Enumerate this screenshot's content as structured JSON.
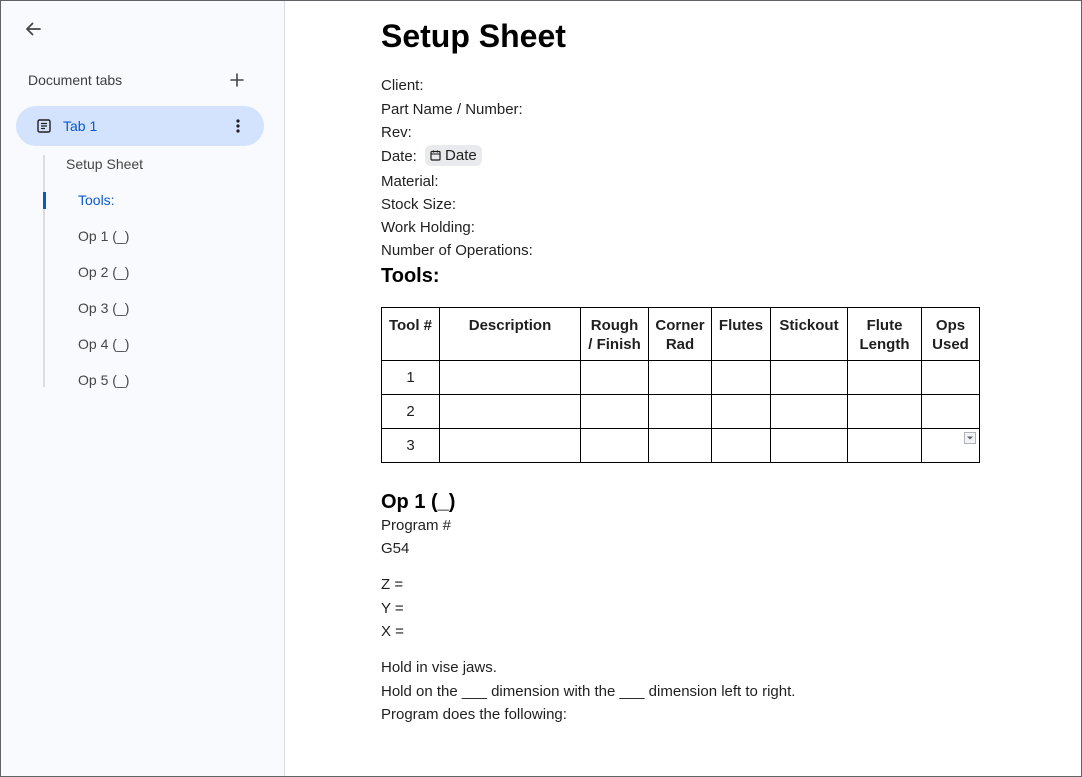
{
  "sidebar": {
    "tabs_header": "Document tabs",
    "active_tab": {
      "label": "Tab 1"
    },
    "outline": [
      {
        "label": "Setup Sheet",
        "active": false
      },
      {
        "label": "Tools:",
        "active": true
      },
      {
        "label": "Op 1 (_)",
        "active": false
      },
      {
        "label": "Op 2 (_)",
        "active": false
      },
      {
        "label": "Op 3 (_)",
        "active": false
      },
      {
        "label": "Op 4 (_)",
        "active": false
      },
      {
        "label": "Op 5 (_)",
        "active": false
      }
    ]
  },
  "document": {
    "title": "Setup Sheet",
    "fields": {
      "client": "Client:",
      "part": "Part Name / Number:",
      "rev": "Rev:",
      "date_label": "Date:",
      "date_chip": "Date",
      "material": "Material:",
      "stock": "Stock Size:",
      "work_holding": "Work Holding:",
      "operations": "Number of Operations:"
    },
    "tools_heading": "Tools:",
    "table": {
      "headers": [
        "Tool #",
        "Description",
        "Rough\n/ Finish",
        "Corner\nRad",
        "Flutes",
        "Stickout",
        "Flute\nLength",
        "Ops\nUsed"
      ],
      "rows": [
        [
          "1",
          "",
          "",
          "",
          "",
          "",
          "",
          ""
        ],
        [
          "2",
          "",
          "",
          "",
          "",
          "",
          "",
          ""
        ],
        [
          "3",
          "",
          "",
          "",
          "",
          "",
          "",
          ""
        ]
      ]
    },
    "op1": {
      "heading": "Op 1 (_)",
      "program": "Program #",
      "work_offset": "G54",
      "z": "Z =",
      "y": "Y =",
      "x": "X =",
      "hold1": "Hold in vise jaws.",
      "hold2": "Hold on the ___  dimension with the ___  dimension left to right.",
      "program_does": "Program does the following:"
    }
  },
  "colors": {
    "sidebar_bg": "#f8fafd",
    "active_tab_bg": "#d3e3fd",
    "accent": "#0b57d0",
    "chip_bg": "#e8eaed"
  },
  "icons": {
    "back": "arrow-left-icon",
    "add": "plus-icon",
    "tab": "document-icon",
    "more": "more-vert-icon",
    "date": "calendar-icon",
    "dropdown": "chevron-down-icon"
  }
}
